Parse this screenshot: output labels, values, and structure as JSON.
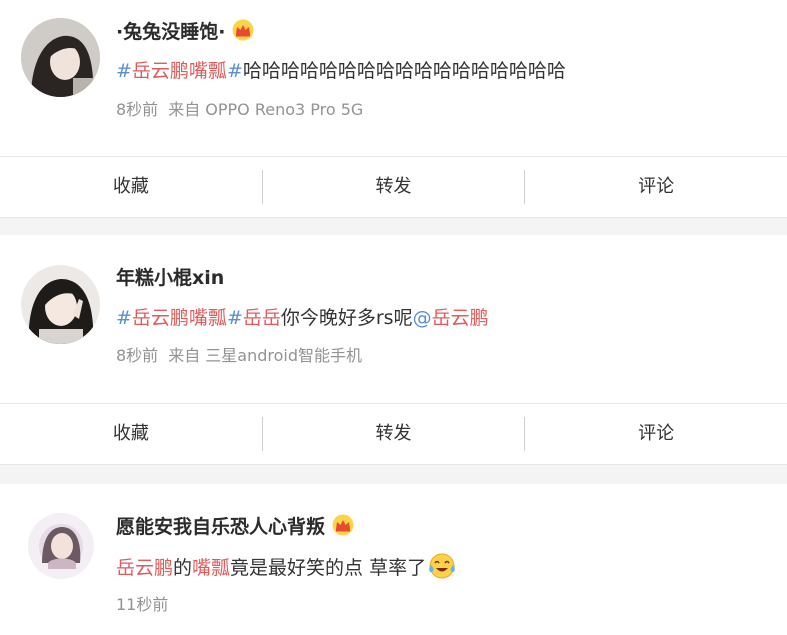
{
  "colors": {
    "topic_hash": "#5b8ed4",
    "topic_text": "#e05b5b",
    "meta_gray": "#939393",
    "separator_bg": "#f4f4f4",
    "crown_gold": "#f5a623"
  },
  "posts": [
    {
      "username": "·兔兔没睡饱·",
      "has_crown": true,
      "content": {
        "hash_open": "#",
        "topic": "岳云鹏嘴瓢",
        "hash_close": "#",
        "text": "哈哈哈哈哈哈哈哈哈哈哈哈哈哈哈哈哈"
      },
      "time": "8秒前",
      "source": "来自 OPPO Reno3 Pro 5G",
      "actions": [
        "收藏",
        "转发",
        "评论"
      ]
    },
    {
      "username": "年糕小棍xin",
      "has_crown": false,
      "content": {
        "hash_open": "#",
        "topic": "岳云鹏嘴瓢",
        "hash_mid": "#",
        "topic2": "岳岳",
        "text": "你今晚好多rs呢",
        "at": "@",
        "mention": "岳云鹏"
      },
      "time": "8秒前",
      "source": "来自 三星android智能手机",
      "actions": [
        "收藏",
        "转发",
        "评论"
      ]
    },
    {
      "username": "愿能安我自乐恐人心背叛",
      "has_crown": true,
      "content": {
        "part1": "岳云鹏",
        "part2": "的",
        "part3": "嘴瓢",
        "part4": "竟是最好笑的点 草率了",
        "emoji": "laugh-cry-emoji"
      },
      "time": "11秒前"
    }
  ]
}
